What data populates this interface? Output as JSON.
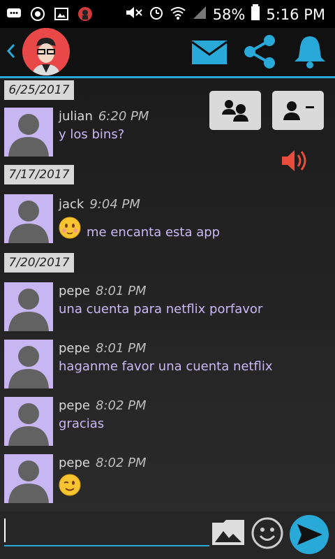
{
  "status": {
    "battery": "58%",
    "time": "5:16 PM"
  },
  "header": {
    "icons": [
      "back-chevron-icon",
      "avatar",
      "mail-icon",
      "share-icon",
      "bell-icon"
    ]
  },
  "side_buttons": {
    "icons": [
      "group-contacts-icon",
      "contact-card-icon",
      "speaker-icon"
    ]
  },
  "dates": [
    "6/25/2017",
    "7/17/2017",
    "7/20/2017"
  ],
  "messages": [
    {
      "name": "julian",
      "time": "6:20 PM",
      "text": "y los bins?"
    },
    {
      "name": "jack",
      "time": "9:04 PM",
      "text": "me encanta esta app"
    },
    {
      "name": "pepe",
      "time": "8:01 PM",
      "text": "una cuenta para netflix porfavor"
    },
    {
      "name": "pepe",
      "time": "8:01 PM",
      "text": "haganme favor una cuenta netflix"
    },
    {
      "name": "pepe",
      "time": "8:02 PM",
      "text": "gracias"
    },
    {
      "name": "pepe",
      "time": "8:02 PM",
      "text": ""
    }
  ],
  "composer": {
    "value": ""
  },
  "colors": {
    "accent": "#29a9d8",
    "avatar_bg": "#c8b6f2",
    "message_text": "#c9b8f6",
    "speaker": "#e84d3c"
  }
}
